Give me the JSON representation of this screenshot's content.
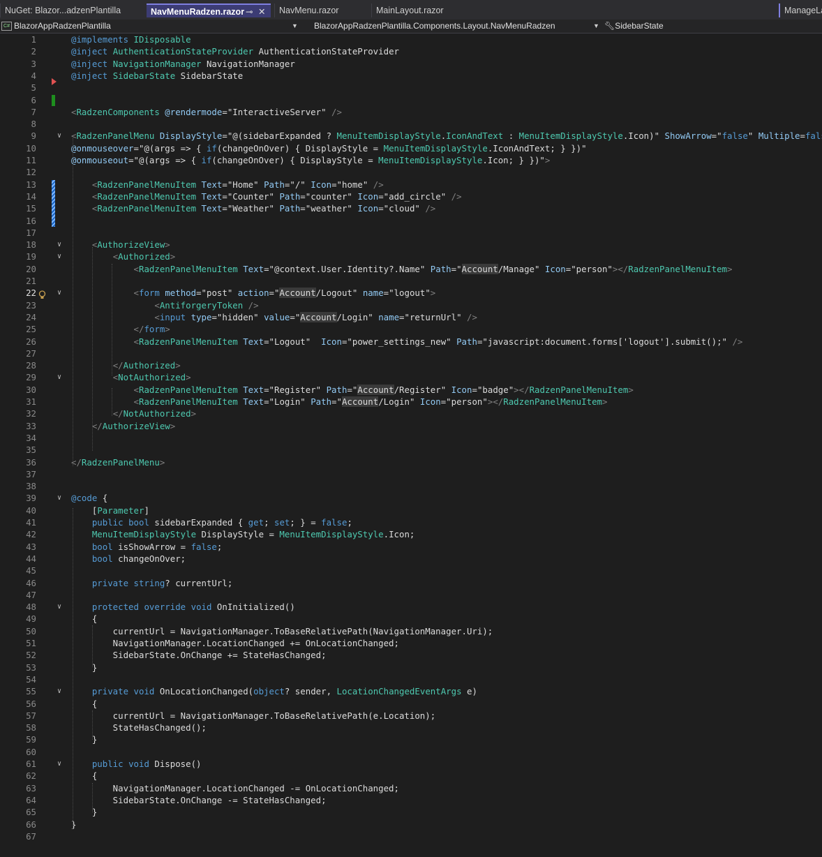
{
  "tabs": [
    {
      "label": "NuGet: Blazor...adzenPlantilla",
      "active": false
    },
    {
      "label": "NavMenuRadzen.razor",
      "active": true
    },
    {
      "label": "NavMenu.razor",
      "active": false
    },
    {
      "label": "MainLayout.razor",
      "active": false
    },
    {
      "label": "ManageLa",
      "active": false
    }
  ],
  "tab_icons": {
    "pin": "pin-icon",
    "close": "close-icon"
  },
  "navbar": {
    "project": "BlazorAppRadzenPlantilla",
    "type": "BlazorAppRadzenPlantilla.Components.Layout.NavMenuRadzen",
    "member": "SidebarState",
    "project_icon": "csharp-project-icon",
    "member_icon": "wrench-icon"
  },
  "editor": {
    "current_line": 22,
    "colors": {
      "keyword": "#569cd6",
      "type": "#4ec9b0",
      "string": "#d69d85",
      "attribute": "#92caf4",
      "text": "#dcdcdc",
      "breakpoint_marker": "#e05252",
      "changed_marker": "#1e8f1e"
    },
    "lines": [
      [
        [
          "k",
          "@implements"
        ],
        [
          "p",
          " "
        ],
        [
          "t",
          "IDisposable"
        ]
      ],
      [
        [
          "k",
          "@inject"
        ],
        [
          "p",
          " "
        ],
        [
          "t",
          "AuthenticationStateProvider"
        ],
        [
          "p",
          " AuthenticationStateProvider"
        ]
      ],
      [
        [
          "k",
          "@inject"
        ],
        [
          "p",
          " "
        ],
        [
          "t",
          "NavigationManager"
        ],
        [
          "p",
          " NavigationManager"
        ]
      ],
      [
        [
          "k",
          "@inject"
        ],
        [
          "p",
          " "
        ],
        [
          "t",
          "SidebarState"
        ],
        [
          "p",
          " SidebarState"
        ]
      ],
      [],
      [],
      [
        [
          "d",
          "<"
        ],
        [
          "rz",
          "RadzenComponents"
        ],
        [
          "p",
          " "
        ],
        [
          "a",
          "@rendermode"
        ],
        [
          "p",
          "=\"InteractiveServer\""
        ],
        [
          "d",
          " />"
        ]
      ],
      [],
      [
        [
          "d",
          "<"
        ],
        [
          "rz",
          "RadzenPanelMenu"
        ],
        [
          "p",
          " "
        ],
        [
          "a",
          "DisplayStyle"
        ],
        [
          "p",
          "=\"@(sidebarExpanded ? "
        ],
        [
          "t",
          "MenuItemDisplayStyle"
        ],
        [
          "p",
          "."
        ],
        [
          "t",
          "IconAndText"
        ],
        [
          "p",
          " : "
        ],
        [
          "t",
          "MenuItemDisplayStyle"
        ],
        [
          "p",
          ".Icon)\" "
        ],
        [
          "a",
          "ShowArrow"
        ],
        [
          "p",
          "=\""
        ],
        [
          "k",
          "false"
        ],
        [
          "p",
          "\" "
        ],
        [
          "a",
          "Multiple"
        ],
        [
          "p",
          "="
        ],
        [
          "k",
          "false"
        ]
      ],
      [
        [
          "a",
          "@onmouseover"
        ],
        [
          "p",
          "=\"@(args => { "
        ],
        [
          "k",
          "if"
        ],
        [
          "p",
          "(changeOnOver) { DisplayStyle = "
        ],
        [
          "t",
          "MenuItemDisplayStyle"
        ],
        [
          "p",
          ".IconAndText; } })\""
        ]
      ],
      [
        [
          "a",
          "@onmouseout"
        ],
        [
          "p",
          "=\"@(args => { "
        ],
        [
          "k",
          "if"
        ],
        [
          "p",
          "(changeOnOver) { DisplayStyle = "
        ],
        [
          "t",
          "MenuItemDisplayStyle"
        ],
        [
          "p",
          ".Icon; } })\""
        ],
        [
          "d",
          ">"
        ]
      ],
      [],
      [
        [
          "p",
          "    "
        ],
        [
          "d",
          "<"
        ],
        [
          "rz",
          "RadzenPanelMenuItem"
        ],
        [
          "p",
          " "
        ],
        [
          "a",
          "Text"
        ],
        [
          "p",
          "=\"Home\" "
        ],
        [
          "a",
          "Path"
        ],
        [
          "p",
          "=\"/\" "
        ],
        [
          "a",
          "Icon"
        ],
        [
          "p",
          "=\"home\" "
        ],
        [
          "d",
          "/>"
        ]
      ],
      [
        [
          "p",
          "    "
        ],
        [
          "d",
          "<"
        ],
        [
          "rz",
          "RadzenPanelMenuItem"
        ],
        [
          "p",
          " "
        ],
        [
          "a",
          "Text"
        ],
        [
          "p",
          "=\"Counter\" "
        ],
        [
          "a",
          "Path"
        ],
        [
          "p",
          "=\"counter\" "
        ],
        [
          "a",
          "Icon"
        ],
        [
          "p",
          "=\"add_circle\" "
        ],
        [
          "d",
          "/>"
        ]
      ],
      [
        [
          "p",
          "    "
        ],
        [
          "d",
          "<"
        ],
        [
          "rz",
          "RadzenPanelMenuItem"
        ],
        [
          "p",
          " "
        ],
        [
          "a",
          "Text"
        ],
        [
          "p",
          "=\"Weather\" "
        ],
        [
          "a",
          "Path"
        ],
        [
          "p",
          "=\"weather\" "
        ],
        [
          "a",
          "Icon"
        ],
        [
          "p",
          "=\"cloud\" "
        ],
        [
          "d",
          "/>"
        ]
      ],
      [],
      [],
      [
        [
          "p",
          "    "
        ],
        [
          "d",
          "<"
        ],
        [
          "rz",
          "AuthorizeView"
        ],
        [
          "d",
          ">"
        ]
      ],
      [
        [
          "p",
          "        "
        ],
        [
          "d",
          "<"
        ],
        [
          "rz",
          "Authorized"
        ],
        [
          "d",
          ">"
        ]
      ],
      [
        [
          "p",
          "            "
        ],
        [
          "d",
          "<"
        ],
        [
          "rz",
          "RadzenPanelMenuItem"
        ],
        [
          "p",
          " "
        ],
        [
          "a",
          "Text"
        ],
        [
          "p",
          "=\"@context.User.Identity?.Name\" "
        ],
        [
          "a",
          "Path"
        ],
        [
          "p",
          "=\""
        ],
        [
          "hl",
          "Account"
        ],
        [
          "p",
          "/Manage\" "
        ],
        [
          "a",
          "Icon"
        ],
        [
          "p",
          "=\"person\""
        ],
        [
          "d",
          "></"
        ],
        [
          "rz",
          "RadzenPanelMenuItem"
        ],
        [
          "d",
          ">"
        ]
      ],
      [],
      [
        [
          "p",
          "            "
        ],
        [
          "d",
          "<"
        ],
        [
          "tg",
          "form"
        ],
        [
          "p",
          " "
        ],
        [
          "a",
          "method"
        ],
        [
          "p",
          "=\"post\" "
        ],
        [
          "a",
          "action"
        ],
        [
          "p",
          "=\""
        ],
        [
          "hl",
          "Account"
        ],
        [
          "p",
          "/Logout\" "
        ],
        [
          "a",
          "name"
        ],
        [
          "p",
          "=\"logout\""
        ],
        [
          "d",
          ">"
        ]
      ],
      [
        [
          "p",
          "                "
        ],
        [
          "d",
          "<"
        ],
        [
          "rz",
          "AntiforgeryToken"
        ],
        [
          "p",
          " "
        ],
        [
          "d",
          "/>"
        ]
      ],
      [
        [
          "p",
          "                "
        ],
        [
          "d",
          "<"
        ],
        [
          "tg",
          "input"
        ],
        [
          "p",
          " "
        ],
        [
          "a",
          "type"
        ],
        [
          "p",
          "=\"hidden\" "
        ],
        [
          "a",
          "value"
        ],
        [
          "p",
          "=\""
        ],
        [
          "hl",
          "Account"
        ],
        [
          "p",
          "/Login\" "
        ],
        [
          "a",
          "name"
        ],
        [
          "p",
          "=\"returnUrl\" "
        ],
        [
          "d",
          "/>"
        ]
      ],
      [
        [
          "p",
          "            "
        ],
        [
          "d",
          "</"
        ],
        [
          "tg",
          "form"
        ],
        [
          "d",
          ">"
        ]
      ],
      [
        [
          "p",
          "            "
        ],
        [
          "d",
          "<"
        ],
        [
          "rz",
          "RadzenPanelMenuItem"
        ],
        [
          "p",
          " "
        ],
        [
          "a",
          "Text"
        ],
        [
          "p",
          "=\"Logout\"  "
        ],
        [
          "a",
          "Icon"
        ],
        [
          "p",
          "=\"power_settings_new\" "
        ],
        [
          "a",
          "Path"
        ],
        [
          "p",
          "=\"javascript:document.forms['logout'].submit();\" "
        ],
        [
          "d",
          "/>"
        ]
      ],
      [],
      [
        [
          "p",
          "        "
        ],
        [
          "d",
          "</"
        ],
        [
          "rz",
          "Authorized"
        ],
        [
          "d",
          ">"
        ]
      ],
      [
        [
          "p",
          "        "
        ],
        [
          "d",
          "<"
        ],
        [
          "rz",
          "NotAuthorized"
        ],
        [
          "d",
          ">"
        ]
      ],
      [
        [
          "p",
          "            "
        ],
        [
          "d",
          "<"
        ],
        [
          "rz",
          "RadzenPanelMenuItem"
        ],
        [
          "p",
          " "
        ],
        [
          "a",
          "Text"
        ],
        [
          "p",
          "=\"Register\" "
        ],
        [
          "a",
          "Path"
        ],
        [
          "p",
          "=\""
        ],
        [
          "hl",
          "Account"
        ],
        [
          "p",
          "/Register\" "
        ],
        [
          "a",
          "Icon"
        ],
        [
          "p",
          "=\"badge\""
        ],
        [
          "d",
          "></"
        ],
        [
          "rz",
          "RadzenPanelMenuItem"
        ],
        [
          "d",
          ">"
        ]
      ],
      [
        [
          "p",
          "            "
        ],
        [
          "d",
          "<"
        ],
        [
          "rz",
          "RadzenPanelMenuItem"
        ],
        [
          "p",
          " "
        ],
        [
          "a",
          "Text"
        ],
        [
          "p",
          "=\"Login\" "
        ],
        [
          "a",
          "Path"
        ],
        [
          "p",
          "=\""
        ],
        [
          "hl",
          "Account"
        ],
        [
          "p",
          "/Login\" "
        ],
        [
          "a",
          "Icon"
        ],
        [
          "p",
          "=\"person\""
        ],
        [
          "d",
          "></"
        ],
        [
          "rz",
          "RadzenPanelMenuItem"
        ],
        [
          "d",
          ">"
        ]
      ],
      [
        [
          "p",
          "        "
        ],
        [
          "d",
          "</"
        ],
        [
          "rz",
          "NotAuthorized"
        ],
        [
          "d",
          ">"
        ]
      ],
      [
        [
          "p",
          "    "
        ],
        [
          "d",
          "</"
        ],
        [
          "rz",
          "AuthorizeView"
        ],
        [
          "d",
          ">"
        ]
      ],
      [],
      [],
      [
        [
          "d",
          "</"
        ],
        [
          "rz",
          "RadzenPanelMenu"
        ],
        [
          "d",
          ">"
        ]
      ],
      [],
      [],
      [
        [
          "k",
          "@code"
        ],
        [
          "p",
          " {"
        ]
      ],
      [
        [
          "p",
          "    ["
        ],
        [
          "t",
          "Parameter"
        ],
        [
          "p",
          "]"
        ]
      ],
      [
        [
          "p",
          "    "
        ],
        [
          "k",
          "public"
        ],
        [
          "p",
          " "
        ],
        [
          "k",
          "bool"
        ],
        [
          "p",
          " sidebarExpanded { "
        ],
        [
          "k",
          "get"
        ],
        [
          "p",
          "; "
        ],
        [
          "k",
          "set"
        ],
        [
          "p",
          "; } = "
        ],
        [
          "k",
          "false"
        ],
        [
          "p",
          ";"
        ]
      ],
      [
        [
          "p",
          "    "
        ],
        [
          "t",
          "MenuItemDisplayStyle"
        ],
        [
          "p",
          " DisplayStyle = "
        ],
        [
          "t",
          "MenuItemDisplayStyle"
        ],
        [
          "p",
          ".Icon;"
        ]
      ],
      [
        [
          "p",
          "    "
        ],
        [
          "k",
          "bool"
        ],
        [
          "p",
          " isShowArrow = "
        ],
        [
          "k",
          "false"
        ],
        [
          "p",
          ";"
        ]
      ],
      [
        [
          "p",
          "    "
        ],
        [
          "k",
          "bool"
        ],
        [
          "p",
          " changeOnOver;"
        ]
      ],
      [],
      [
        [
          "p",
          "    "
        ],
        [
          "k",
          "private"
        ],
        [
          "p",
          " "
        ],
        [
          "k",
          "string"
        ],
        [
          "p",
          "? currentUrl;"
        ]
      ],
      [],
      [
        [
          "p",
          "    "
        ],
        [
          "k",
          "protected"
        ],
        [
          "p",
          " "
        ],
        [
          "k",
          "override"
        ],
        [
          "p",
          " "
        ],
        [
          "k",
          "void"
        ],
        [
          "p",
          " OnInitialized()"
        ]
      ],
      [
        [
          "p",
          "    {"
        ]
      ],
      [
        [
          "p",
          "        currentUrl = NavigationManager.ToBaseRelativePath(NavigationManager.Uri);"
        ]
      ],
      [
        [
          "p",
          "        NavigationManager.LocationChanged += OnLocationChanged;"
        ]
      ],
      [
        [
          "p",
          "        SidebarState.OnChange += StateHasChanged;"
        ]
      ],
      [
        [
          "p",
          "    }"
        ]
      ],
      [],
      [
        [
          "p",
          "    "
        ],
        [
          "k",
          "private"
        ],
        [
          "p",
          " "
        ],
        [
          "k",
          "void"
        ],
        [
          "p",
          " OnLocationChanged("
        ],
        [
          "k",
          "object"
        ],
        [
          "p",
          "? sender, "
        ],
        [
          "t",
          "LocationChangedEventArgs"
        ],
        [
          "p",
          " e)"
        ]
      ],
      [
        [
          "p",
          "    {"
        ]
      ],
      [
        [
          "p",
          "        currentUrl = NavigationManager.ToBaseRelativePath(e.Location);"
        ]
      ],
      [
        [
          "p",
          "        StateHasChanged();"
        ]
      ],
      [
        [
          "p",
          "    }"
        ]
      ],
      [],
      [
        [
          "p",
          "    "
        ],
        [
          "k",
          "public"
        ],
        [
          "p",
          " "
        ],
        [
          "k",
          "void"
        ],
        [
          "p",
          " Dispose()"
        ]
      ],
      [
        [
          "p",
          "    {"
        ]
      ],
      [
        [
          "p",
          "        NavigationManager.LocationChanged -= OnLocationChanged;"
        ]
      ],
      [
        [
          "p",
          "        SidebarState.OnChange -= StateHasChanged;"
        ]
      ],
      [
        [
          "p",
          "    }"
        ]
      ],
      [
        [
          "p",
          "}"
        ]
      ],
      []
    ]
  }
}
